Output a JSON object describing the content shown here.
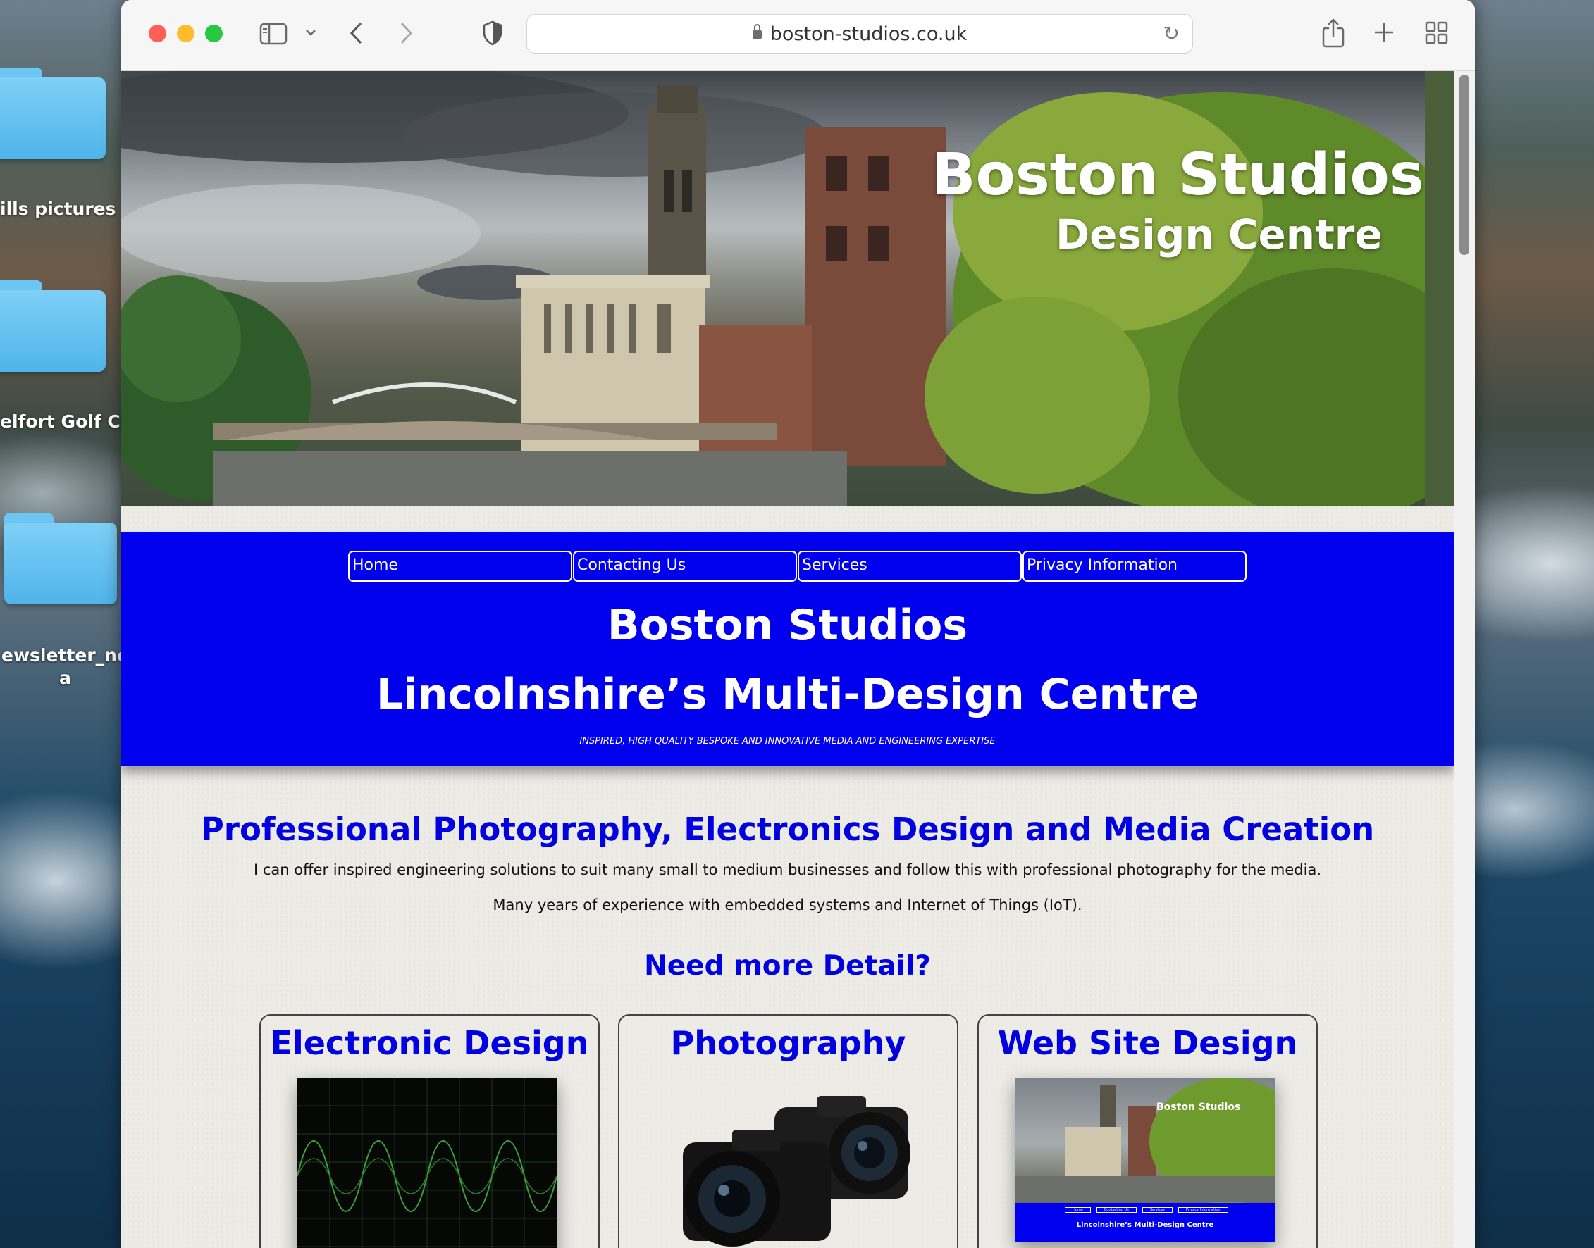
{
  "desktop": {
    "folders": [
      {
        "label": "ills pictures"
      },
      {
        "label": "elfort Golf Clu"
      },
      {
        "label_line1": "ewsletter_nes",
        "label_line2": "a"
      }
    ]
  },
  "browser": {
    "url": "boston-studios.co.uk"
  },
  "hero": {
    "title": "Boston Studios",
    "subtitle": "Design Centre"
  },
  "nav": {
    "items": [
      {
        "label": "Home"
      },
      {
        "label": "Contacting Us"
      },
      {
        "label": "Services"
      },
      {
        "label": "Privacy Information"
      }
    ]
  },
  "banner": {
    "title": "Boston Studios",
    "subtitle": "Lincolnshire’s Multi-Design Centre",
    "tagline": "INSPIRED, HIGH QUALITY BESPOKE AND INNOVATIVE MEDIA AND ENGINEERING EXPERTISE"
  },
  "main": {
    "heading": "Professional Photography, Electronics Design and Media Creation",
    "paragraph1": "I can offer inspired engineering solutions to suit many small to medium businesses and follow this with professional photography for the media.",
    "paragraph2": "Many years of experience with embedded systems and Internet of Things (IoT).",
    "more_heading": "Need more Detail?"
  },
  "cards": [
    {
      "title": "Electronic Design"
    },
    {
      "title": "Photography"
    },
    {
      "title": "Web Site Design",
      "thumb_title": "Boston Studios",
      "thumb_banner": "Lincolnshire’s Multi-Design Centre",
      "thumb_nav": [
        "Home",
        "Contacting Us",
        "Services",
        "Privacy Information"
      ]
    }
  ],
  "colors": {
    "accent_blue": "#0000ee",
    "heading_blue": "#0000e0"
  }
}
